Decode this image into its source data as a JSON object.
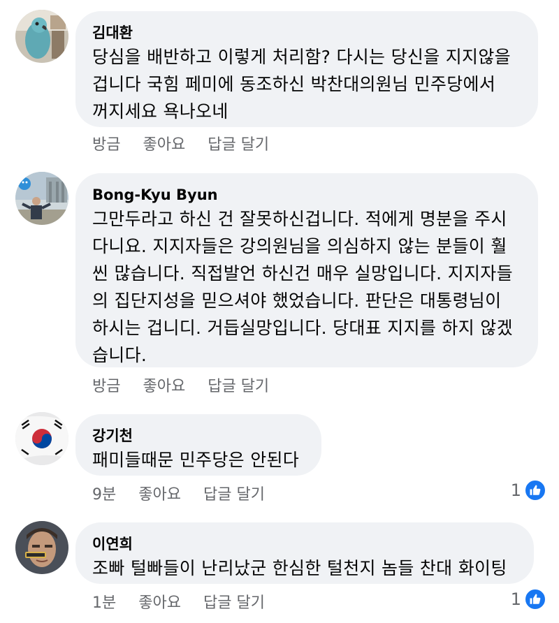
{
  "comments": [
    {
      "author": "김대환",
      "text": "당심을 배반하고 이렇게 처리함? 다시는 당신을 지지않을\n겁니다 국힘 페미에 동조하신 박찬대의원님 민주당에서\n꺼지세요 욕나오네",
      "time": "방금",
      "like_label": "좋아요",
      "reply_label": "답글 달기"
    },
    {
      "author": "Bong-Kyu Byun",
      "text": "그만두라고 하신 건 잘못하신겁니다. 적에게 명분을 주시\n다니요. 지지자들은 강의원님을 의심하지 않는 분들이 훨\n씬 많습니다. 직접발언 하신건 매우 실망입니다. 지지자들\n의 집단지성을 믿으셔야 했었습니다. 판단은 대통령님이\n하시는 겁니디. 거듭실망입니다. 당대표 지지를 하지 않겠\n습니다.",
      "time": "방금",
      "like_label": "좋아요",
      "reply_label": "답글 달기"
    },
    {
      "author": "강기천",
      "text": "패미들때문 민주당은 안된다",
      "time": "9분",
      "like_label": "좋아요",
      "reply_label": "답글 달기",
      "reaction_count": "1"
    },
    {
      "author": "이연희",
      "text": "조빠 털빠들이 난리났군 한심한 털천지 놈들 찬대 화이팅",
      "time": "1분",
      "like_label": "좋아요",
      "reply_label": "답글 달기",
      "reaction_count": "1"
    }
  ],
  "colors": {
    "bubble_bg": "#f0f2f5",
    "meta_text": "#65676b",
    "like_blue": "#1877f2"
  }
}
